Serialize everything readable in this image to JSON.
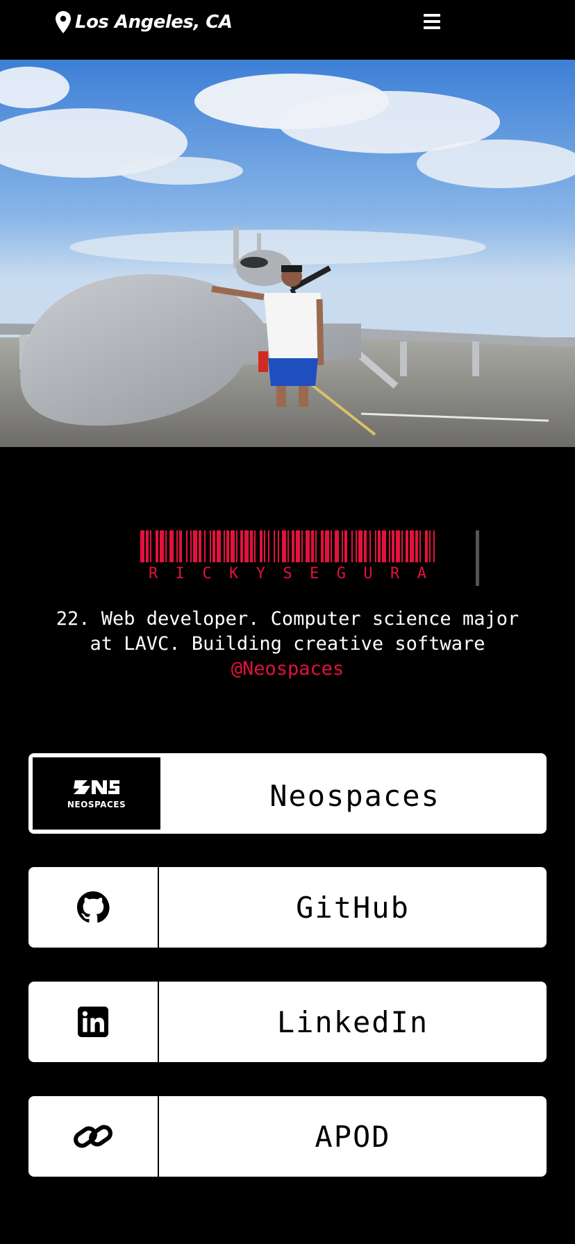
{
  "header": {
    "location": "Los Angeles, CA",
    "location_icon": "map-pin-icon",
    "menu_icon": "hamburger-menu-icon"
  },
  "hero": {
    "description_icon": "hero-photo"
  },
  "profile": {
    "name_letters": [
      "R",
      "I",
      "C",
      "K",
      "Y",
      "S",
      "E",
      "G",
      "U",
      "R",
      "A"
    ],
    "accent_color": "#e3123c",
    "bio_text": "22. Web developer. Computer science major at LAVC. Building creative software ",
    "bio_handle": "@Neospaces"
  },
  "links": [
    {
      "label": "Neospaces",
      "icon": "neospaces-logo-icon",
      "logo_text": "NEOSPACES"
    },
    {
      "label": "GitHub",
      "icon": "github-icon"
    },
    {
      "label": "LinkedIn",
      "icon": "linkedin-icon"
    },
    {
      "label": "APOD",
      "icon": "link-icon"
    }
  ]
}
